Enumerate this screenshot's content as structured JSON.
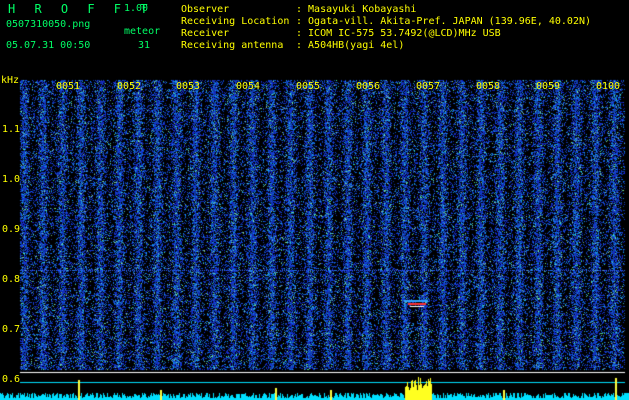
{
  "header": {
    "app_title": "H R O F F T",
    "app_version": "1.00",
    "file_name": "0507310050.png",
    "meteor_label": "meteor",
    "datetime": "05.07.31 00:50",
    "meteor_count": "31"
  },
  "info": [
    {
      "key": "Observer",
      "value": ": Masayuki Kobayashi"
    },
    {
      "key": "Receiving Location",
      "value": ": Ogata-vill. Akita-Pref. JAPAN (139.96E, 40.02N)"
    },
    {
      "key": "Receiver",
      "value": ": ICOM IC-575 53.7492(@LCD)MHz USB"
    },
    {
      "key": "Receiving antenna",
      "value": ": A504HB(yagi 4el)"
    }
  ],
  "axis": {
    "unit": "kHz",
    "ticks": [
      "1.1",
      "1.0",
      "0.9",
      "0.8",
      "0.7",
      "0.6"
    ],
    "time_labels": [
      "0051",
      "0052",
      "0053",
      "0054",
      "0055",
      "0056",
      "0057",
      "0058",
      "0059",
      "0100"
    ]
  },
  "colors": {
    "text_green": "#00ff66",
    "text_yellow": "#ffff00",
    "background": "#000000",
    "signal_blue": "#1030c0",
    "baseline_cyan": "#00e0ff"
  }
}
